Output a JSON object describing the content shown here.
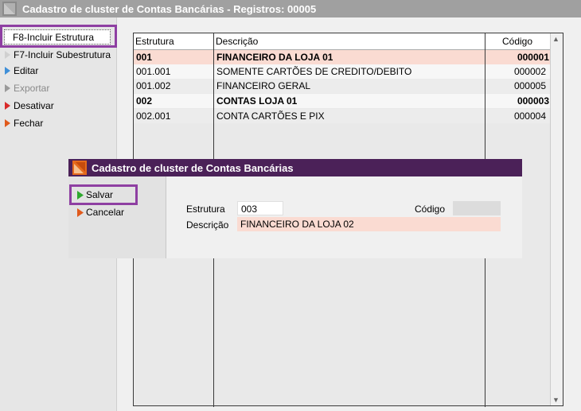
{
  "window": {
    "title": "Cadastro de cluster de Contas Bancárias - Registros: 00005"
  },
  "sidebar": {
    "items": [
      {
        "label": "F8-Incluir Estrutura",
        "icon": "arrow-right-icon",
        "state": "selected"
      },
      {
        "label": "F7-Incluir Subestrutura",
        "icon": "arrow-right-icon",
        "state": "normal"
      },
      {
        "label": "Editar",
        "icon": "arrow-right-icon",
        "state": "normal"
      },
      {
        "label": "Exportar",
        "icon": "arrow-right-icon",
        "state": "disabled"
      },
      {
        "label": "Desativar",
        "icon": "arrow-right-icon",
        "state": "normal"
      },
      {
        "label": "Fechar",
        "icon": "arrow-right-icon",
        "state": "normal"
      }
    ]
  },
  "grid": {
    "columns": [
      "Estrutura",
      "Descrição",
      "Código"
    ],
    "rows": [
      {
        "estrutura": "001",
        "descricao": "FINANCEIRO DA LOJA 01",
        "codigo": "000001",
        "bold": true,
        "selected": true
      },
      {
        "estrutura": "001.001",
        "descricao": "SOMENTE CARTÕES DE CREDITO/DEBITO",
        "codigo": "000002",
        "bold": false,
        "selected": false
      },
      {
        "estrutura": "001.002",
        "descricao": "FINANCEIRO GERAL",
        "codigo": "000005",
        "bold": false,
        "selected": false
      },
      {
        "estrutura": "002",
        "descricao": "CONTAS LOJA 01",
        "codigo": "000003",
        "bold": true,
        "selected": false
      },
      {
        "estrutura": "002.001",
        "descricao": "CONTA CARTÕES E PIX",
        "codigo": "000004",
        "bold": false,
        "selected": false
      }
    ]
  },
  "dialog": {
    "title": "Cadastro de cluster de Contas Bancárias",
    "buttons": [
      {
        "label": "Salvar",
        "arrow_color": "#2ea82e"
      },
      {
        "label": "Cancelar",
        "arrow_color": "#e05a1c"
      }
    ],
    "fields": {
      "estrutura_label": "Estrutura",
      "estrutura_value": "003",
      "codigo_label": "Código",
      "codigo_value": "",
      "descricao_label": "Descrição",
      "descricao_value": "FINANCEIRO DA LOJA 02"
    }
  },
  "colors": {
    "highlight_box": "#8e3fa2",
    "dialog_title_bar": "#4b2158",
    "selected_row": "#fadbd2",
    "title_bar": "#a0a0a0"
  }
}
